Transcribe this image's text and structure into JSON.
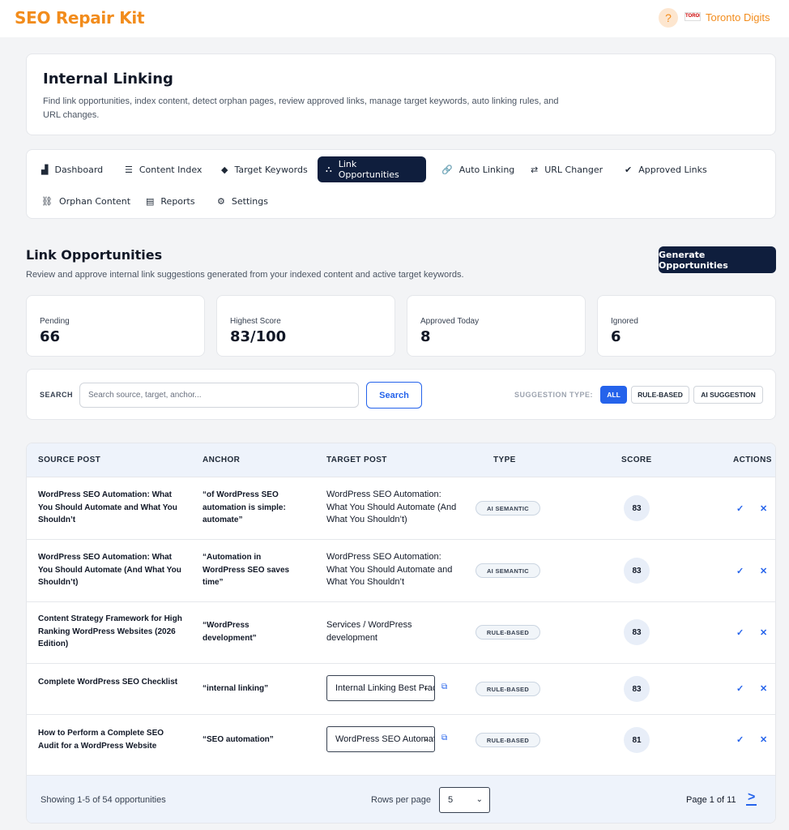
{
  "app": {
    "title": "SEO Repair Kit",
    "help_icon": "?",
    "company_logo_text": "TORONTO DIGITS",
    "company": "Toronto Digits",
    "accent": "#f28c1c",
    "nav_active_bg": "#0f1e3d",
    "link_color": "#2563eb"
  },
  "header": {
    "title": "Internal Linking",
    "description": "Find link opportunities, index content, detect orphan pages, review approved links, manage target keywords, auto linking rules, and URL changes."
  },
  "nav": [
    {
      "label": "Dashboard",
      "icon": "chart-icon",
      "glyph": "▟"
    },
    {
      "label": "Content Index",
      "icon": "database-icon",
      "glyph": "☰"
    },
    {
      "label": "Target Keywords",
      "icon": "tag-icon",
      "glyph": "◆"
    },
    {
      "label": "Link Opportunities",
      "icon": "sitemap-icon",
      "glyph": "⛬",
      "active": true
    },
    {
      "label": "Auto Linking",
      "icon": "link-icon",
      "glyph": "🔗"
    },
    {
      "label": "URL Changer",
      "icon": "shuffle-icon",
      "glyph": "⇄"
    },
    {
      "label": "Approved Links",
      "icon": "check-circle-icon",
      "glyph": "✔"
    },
    {
      "label": "Orphan Content",
      "icon": "unlink-icon",
      "glyph": "⛓"
    },
    {
      "label": "Reports",
      "icon": "report-icon",
      "glyph": "▤"
    },
    {
      "label": "Settings",
      "icon": "gear-icon",
      "glyph": "⚙"
    }
  ],
  "section": {
    "title": "Link Opportunities",
    "subtitle": "Review and approve internal link suggestions generated from your indexed content and active target keywords.",
    "generate_label": "Generate Opportunities"
  },
  "stats": [
    {
      "label": "Pending",
      "value": "66"
    },
    {
      "label": "Highest Score",
      "value": "83/100"
    },
    {
      "label": "Approved Today",
      "value": "8"
    },
    {
      "label": "Ignored",
      "value": "6"
    }
  ],
  "search": {
    "label": "SEARCH",
    "placeholder": "Search source, target, anchor...",
    "value": "",
    "button": "Search",
    "type_label": "SUGGESTION TYPE:",
    "types": [
      "ALL",
      "RULE-BASED",
      "AI SUGGESTION"
    ],
    "selected_type": "ALL"
  },
  "table": {
    "columns": [
      "SOURCE POST",
      "ANCHOR",
      "TARGET POST",
      "TYPE",
      "SCORE",
      "ACTIONS"
    ],
    "rows": [
      {
        "source": "WordPress SEO Automation: What You Should Automate and What You Shouldn’t",
        "anchor": "“of WordPress SEO automation is simple: automate”",
        "target": "WordPress SEO Automation: What You Should Automate (And What You Shouldn’t)",
        "type": "AI SEMANTIC",
        "score": "83"
      },
      {
        "source": "WordPress SEO Automation: What You Should Automate (And What You Shouldn’t)",
        "anchor": "“Automation in WordPress SEO saves time”",
        "target": "WordPress SEO Automation: What You Should Automate and What You Shouldn’t",
        "type": "AI SEMANTIC",
        "score": "83"
      },
      {
        "source": "Content Strategy Framework for High Ranking WordPress Websites (2026 Edition)",
        "anchor": "“WordPress development”",
        "target": "Services / WordPress development",
        "type": "RULE-BASED",
        "score": "83"
      },
      {
        "source": "Complete WordPress SEO Checklist",
        "anchor": "“internal linking”",
        "target": "Internal Linking Best Practices",
        "type": "RULE-BASED",
        "score": "83"
      },
      {
        "source": "How to Perform a Complete SEO Audit for a WordPress Website",
        "anchor": "“SEO automation”",
        "target": "WordPress SEO Automation",
        "type": "RULE-BASED",
        "score": "81"
      }
    ],
    "approve_glyph": "✓",
    "reject_glyph": "✕",
    "external_glyph": "⧉"
  },
  "footer": {
    "showing": "Showing 1-5 of 54 opportunities",
    "rows_per_page_label": "Rows per page",
    "rows_per_page": "5",
    "page_info": "Page 1 of 11",
    "next_glyph": ">"
  }
}
